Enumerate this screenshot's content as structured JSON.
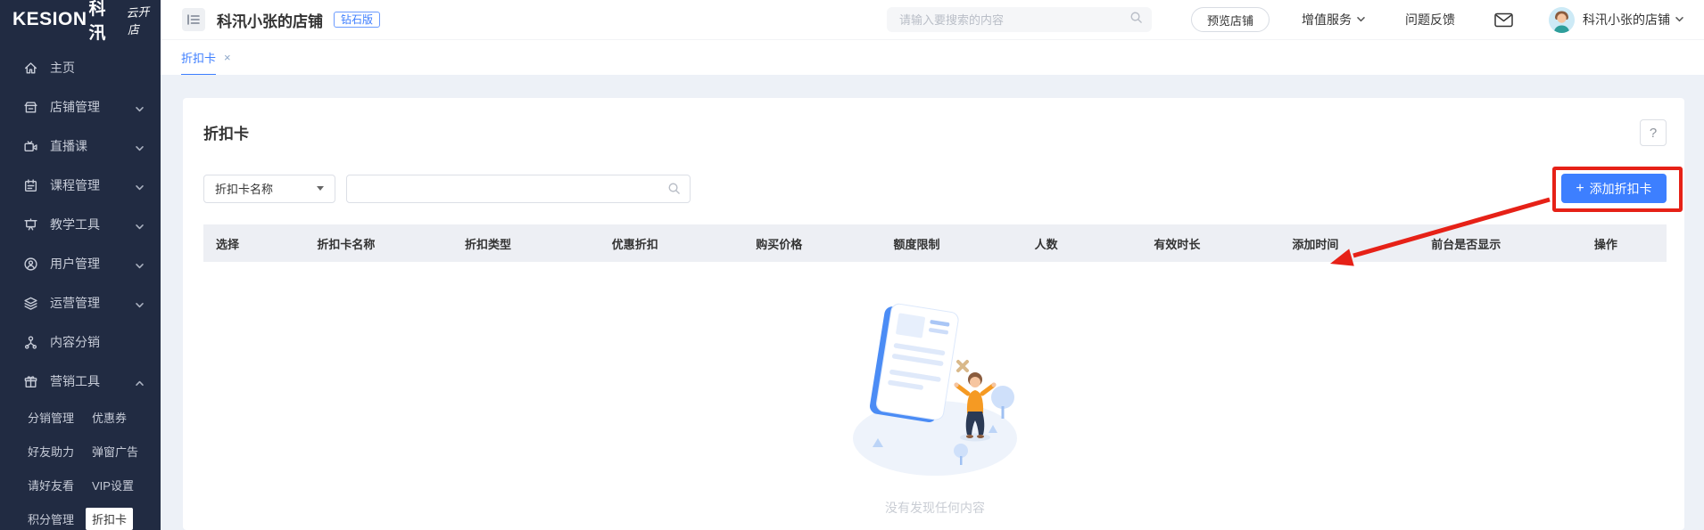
{
  "brand": {
    "logo_en": "KESION",
    "logo_cn": "科汛",
    "logo_script": "云开店"
  },
  "sidebar": {
    "items": [
      {
        "label": "主页",
        "icon": "home-icon",
        "expandable": false
      },
      {
        "label": "店铺管理",
        "icon": "shop-icon",
        "expandable": true
      },
      {
        "label": "直播课",
        "icon": "live-camera-icon",
        "expandable": true
      },
      {
        "label": "课程管理",
        "icon": "course-calendar-icon",
        "expandable": true
      },
      {
        "label": "教学工具",
        "icon": "teaching-board-icon",
        "expandable": true
      },
      {
        "label": "用户管理",
        "icon": "user-icon",
        "expandable": true
      },
      {
        "label": "运营管理",
        "icon": "layers-icon",
        "expandable": true
      },
      {
        "label": "内容分销",
        "icon": "share-network-icon",
        "expandable": false
      },
      {
        "label": "营销工具",
        "icon": "gift-icon",
        "expandable": true,
        "expanded": true
      }
    ],
    "submenu": [
      {
        "label": "分销管理",
        "active": false
      },
      {
        "label": "优惠券",
        "active": false
      },
      {
        "label": "好友助力",
        "active": false
      },
      {
        "label": "弹窗广告",
        "active": false
      },
      {
        "label": "请好友看",
        "active": false
      },
      {
        "label": "VIP设置",
        "active": false
      },
      {
        "label": "积分管理",
        "active": false
      },
      {
        "label": "折扣卡",
        "active": true
      }
    ]
  },
  "topbar": {
    "shop_name": "科汛小张的店铺",
    "edition_badge": "钻石版",
    "search_placeholder": "请输入要搜索的内容",
    "preview_button": "预览店铺",
    "value_added_services": "增值服务",
    "feedback": "问题反馈",
    "account_name": "科汛小张的店铺"
  },
  "tabs": [
    {
      "label": "折扣卡",
      "closable": true,
      "active": true
    }
  ],
  "page": {
    "title": "折扣卡",
    "help_label": "?",
    "filter_field_selected": "折扣卡名称",
    "add_button_plus": "+",
    "add_button_label": "添加折扣卡",
    "table_headers": [
      "选择",
      "折扣卡名称",
      "折扣类型",
      "优惠折扣",
      "购买价格",
      "额度限制",
      "人数",
      "有效时长",
      "添加时间",
      "前台是否显示",
      "操作"
    ],
    "empty_text": "没有发现任何内容"
  },
  "tab_close_glyph": "×",
  "colors": {
    "accent": "#3d7fff",
    "annotation_red": "#e62117",
    "sidebar_bg": "#212b42",
    "table_head_bg": "#edeff4"
  }
}
